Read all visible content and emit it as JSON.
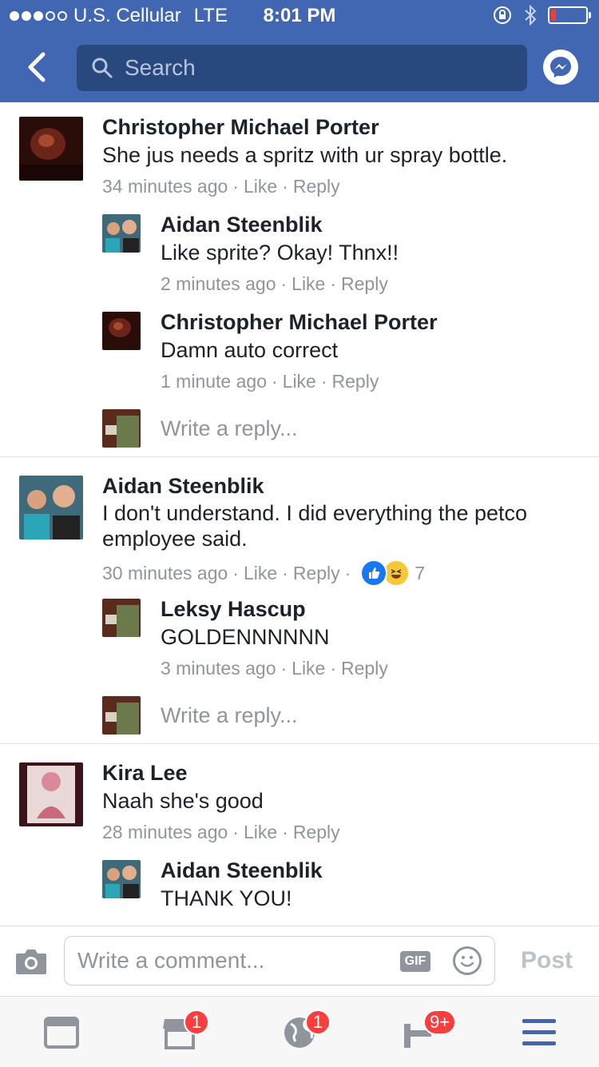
{
  "status": {
    "carrier": "U.S. Cellular",
    "network": "LTE",
    "time": "8:01 PM"
  },
  "search": {
    "placeholder": "Search"
  },
  "comments": [
    {
      "name": "Christopher Michael Porter",
      "text": "She jus needs a spritz with ur spray bottle.",
      "time": "34 minutes ago",
      "like": "Like",
      "reply": "Reply",
      "replies": [
        {
          "name": "Aidan Steenblik",
          "text": "Like sprite? Okay! Thnx!!",
          "time": "2 minutes ago",
          "like": "Like",
          "reply": "Reply"
        },
        {
          "name": "Christopher Michael Porter",
          "text": "Damn auto correct",
          "time": "1 minute ago",
          "like": "Like",
          "reply": "Reply"
        }
      ],
      "write_reply": "Write a reply..."
    },
    {
      "name": "Aidan Steenblik",
      "text": "I don't understand. I did everything the petco employee said.",
      "time": "30 minutes ago",
      "like": "Like",
      "reply": "Reply",
      "reaction_count": "7",
      "replies": [
        {
          "name": "Leksy Hascup",
          "text": "GOLDENNNNNN",
          "time": "3 minutes ago",
          "like": "Like",
          "reply": "Reply"
        }
      ],
      "write_reply": "Write a reply..."
    },
    {
      "name": "Kira Lee",
      "text": "Naah she's good",
      "time": "28 minutes ago",
      "like": "Like",
      "reply": "Reply",
      "replies": [
        {
          "name": "Aidan Steenblik",
          "text": "THANK YOU!"
        }
      ]
    }
  ],
  "comment_bar": {
    "placeholder": "Write a comment...",
    "gif": "GIF",
    "post": "Post"
  },
  "tabs": {
    "marketplace_badge": "1",
    "notifications_badge": "1",
    "requests_badge": "9+"
  },
  "colors": {
    "brand": "#4267b2",
    "badge": "#fa3e3e"
  }
}
